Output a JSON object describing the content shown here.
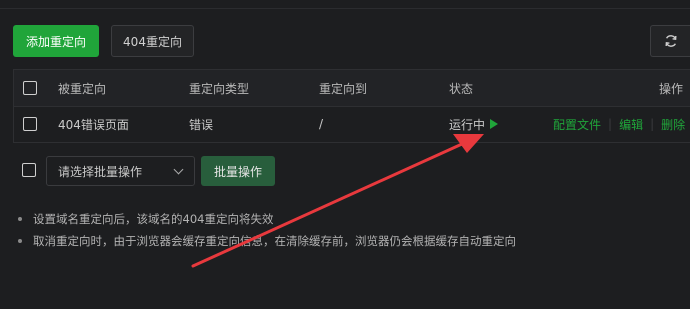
{
  "toolbar": {
    "add_label": "添加重定向",
    "notfound_label": "404重定向",
    "refresh_icon": "refresh-icon"
  },
  "table": {
    "columns": [
      "被重定向",
      "重定向类型",
      "重定向到",
      "状态",
      "操作"
    ],
    "rows": [
      {
        "source": "404错误页面",
        "type": "错误",
        "target": "/",
        "status": "运行中",
        "actions": [
          "配置文件",
          "编辑",
          "删除"
        ]
      }
    ]
  },
  "batch": {
    "select_placeholder": "请选择批量操作",
    "button_label": "批量操作"
  },
  "notes": [
    "设置域名重定向后，该域名的404重定向将失效",
    "取消重定向时，由于浏览器会缓存重定向信息，在清除缓存前，浏览器仍会根据缓存自动重定向"
  ],
  "colors": {
    "accent": "#20a53a",
    "annotation_arrow": "#e8393d"
  }
}
